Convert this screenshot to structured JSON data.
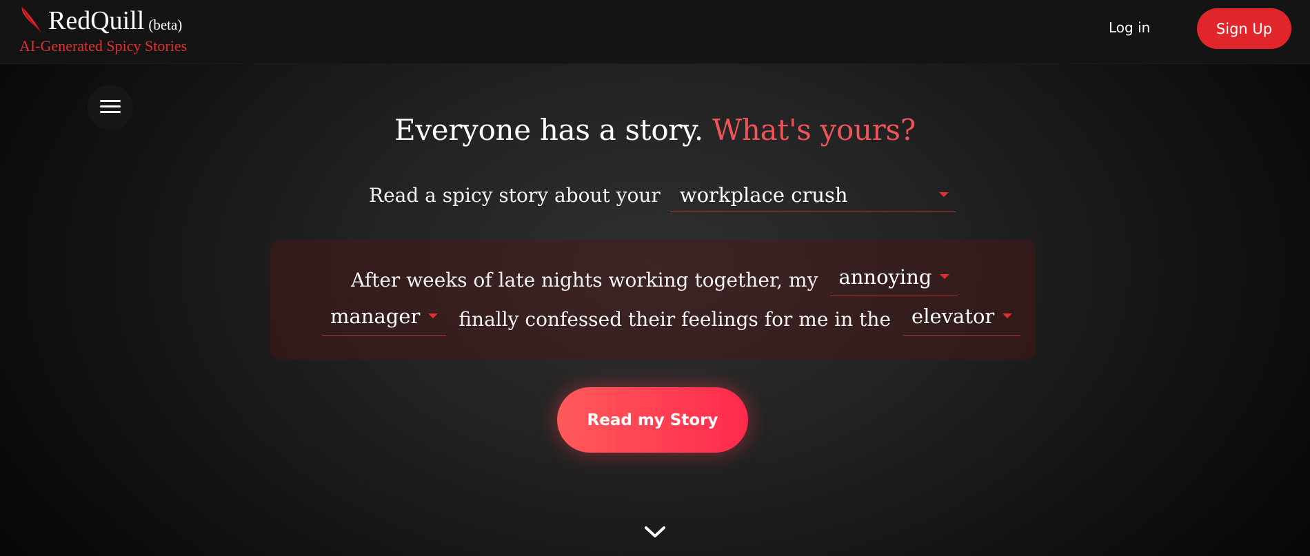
{
  "brand": {
    "name": "RedQuill",
    "beta": "(beta)",
    "tagline": "AI-Generated Spicy Stories"
  },
  "nav": {
    "login": "Log in",
    "signup": "Sign Up"
  },
  "hero": {
    "headline_main": "Everyone has a story.",
    "headline_accent": "What's yours?",
    "prompt_label": "Read a spicy story about your",
    "topic_selected": "workplace crush"
  },
  "story": {
    "part1": "After weeks of late nights working together, my",
    "adjective_selected": "annoying",
    "role_selected": "manager",
    "part2": "finally confessed their feelings for me in the",
    "place_selected": "elevator"
  },
  "cta": {
    "read_label": "Read my Story"
  },
  "icons": {
    "logo": "quill-icon",
    "menu": "hamburger-icon",
    "dropdown": "caret-down-icon",
    "scroll": "chevron-down-icon"
  },
  "colors": {
    "accent": "#e0262a",
    "headline_accent": "#f0545a",
    "tagline": "#e0302f"
  }
}
